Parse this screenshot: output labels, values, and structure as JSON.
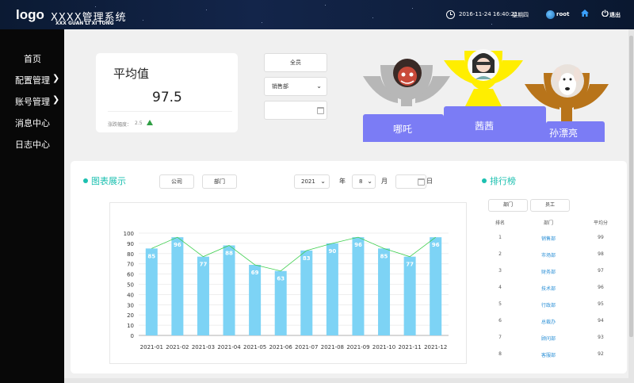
{
  "header": {
    "logo": "logo",
    "system_title": "XXXX管理系统",
    "system_subtitle": "XXX GUAN LI XI TONG",
    "datetime": "2016-11-24 16:40:21",
    "weekday": "星期四",
    "username": "root",
    "logout_label": "退出"
  },
  "sidebar": {
    "items": [
      {
        "label": "首页",
        "has_submenu": false
      },
      {
        "label": "配置管理",
        "has_submenu": true
      },
      {
        "label": "账号管理",
        "has_submenu": true
      },
      {
        "label": "消息中心",
        "has_submenu": false
      },
      {
        "label": "日志中心",
        "has_submenu": false
      }
    ]
  },
  "summary": {
    "title": "平均值",
    "value": "97.5",
    "fluctuation_label": "涨跌幅度：",
    "fluctuation_value": "2.5",
    "trend": "up"
  },
  "filters": {
    "all_button": "全员",
    "department_selected": "销售部",
    "date_value": ""
  },
  "podium": {
    "first": "茜茜",
    "second": "哪吒",
    "third": "孙漂亮",
    "colors": {
      "first": "#ffee00",
      "second": "#b7b7b7",
      "third": "#b8741a",
      "base": "#7b7cf5"
    }
  },
  "chart_section": {
    "title": "图表展示",
    "btn_company": "公司",
    "btn_department": "部门",
    "year_value": "2021",
    "year_label": "年",
    "month_value": "8",
    "month_label": "月",
    "day_label": "日"
  },
  "chart_data": {
    "type": "bar",
    "categories": [
      "2021-01",
      "2021-02",
      "2021-03",
      "2021-04",
      "2021-05",
      "2021-06",
      "2021-07",
      "2021-08",
      "2021-09",
      "2021-10",
      "2021-11",
      "2021-12"
    ],
    "series": [
      {
        "type": "bar",
        "values": [
          85,
          96,
          77,
          88,
          69,
          63,
          83,
          90,
          96,
          85,
          77,
          96
        ],
        "color": "#7dd3f5"
      },
      {
        "type": "line",
        "values": [
          85,
          96,
          77,
          88,
          69,
          63,
          83,
          90,
          96,
          85,
          77,
          96
        ],
        "color": "#3ecf4e"
      }
    ],
    "ylim": [
      0,
      100
    ],
    "yticks": [
      0,
      10,
      20,
      30,
      40,
      50,
      60,
      70,
      80,
      90,
      100
    ],
    "grid": true,
    "data_labels": true
  },
  "ranking": {
    "title": "排行榜",
    "btn_department": "部门",
    "btn_staff": "员工",
    "headers": [
      "排名",
      "部门",
      "平均分"
    ],
    "rows": [
      [
        "1",
        "销售部",
        "99"
      ],
      [
        "2",
        "市场部",
        "98"
      ],
      [
        "3",
        "财务部",
        "97"
      ],
      [
        "4",
        "技术部",
        "96"
      ],
      [
        "5",
        "行政部",
        "95"
      ],
      [
        "6",
        "总裁办",
        "94"
      ],
      [
        "7",
        "顾问部",
        "93"
      ],
      [
        "8",
        "客服部",
        "92"
      ]
    ]
  }
}
